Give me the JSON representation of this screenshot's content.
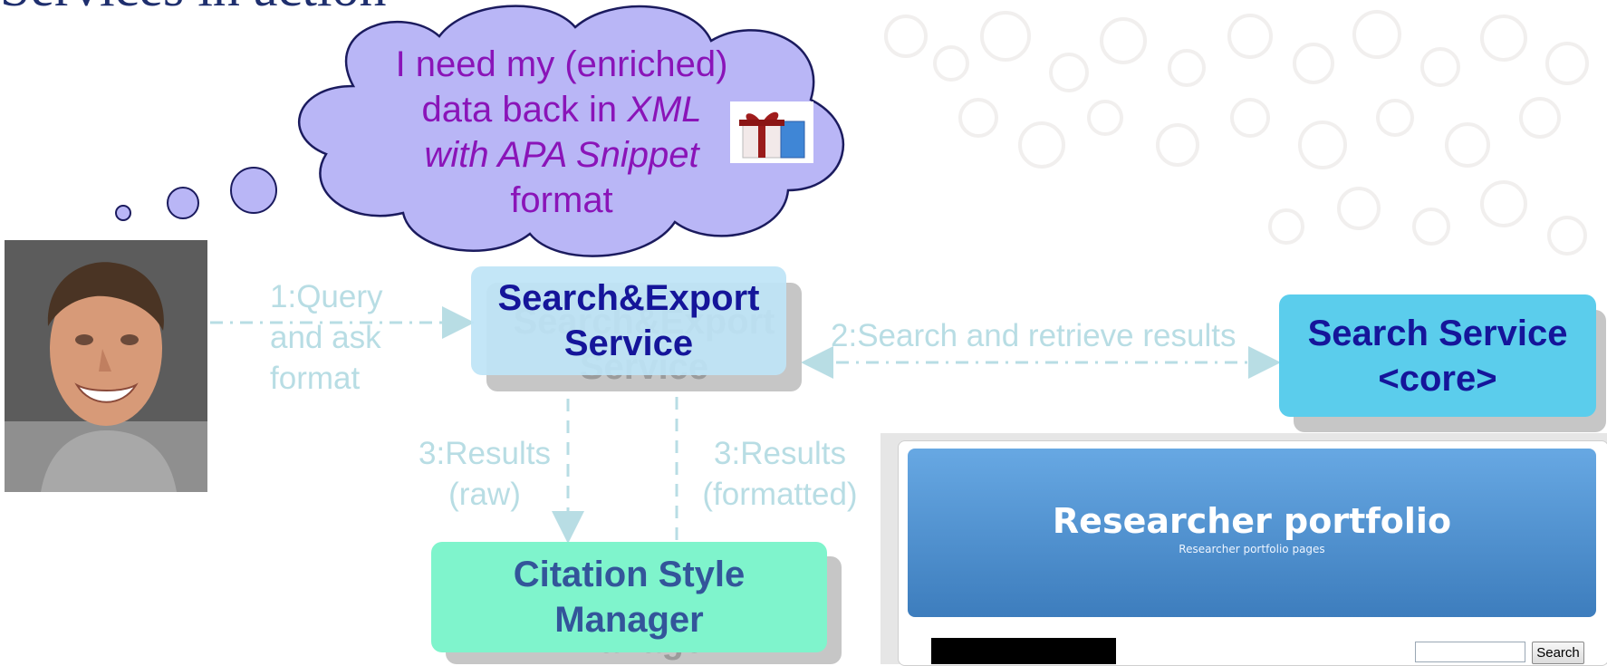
{
  "title": "Services in action",
  "thought": {
    "line1": "I need my (enriched)",
    "line2_prefix": "data back in ",
    "line2_italic": "XML",
    "line3_italic": "with APA Snippet",
    "line4": "format"
  },
  "boxes": {
    "search_export": {
      "line1": "Search&Export",
      "line2": "Service"
    },
    "search_service": {
      "line1": "Search Service",
      "line2": "<core>"
    },
    "citation": {
      "line1": "Citation Style",
      "line2": "Manager"
    }
  },
  "labels": {
    "query": {
      "line1": "1:Query",
      "line2": "and ask",
      "line3": "format"
    },
    "search_retrieve": "2:Search and retrieve results",
    "results_raw": {
      "line1": "3:Results",
      "line2": "(raw)"
    },
    "results_formatted": {
      "line1": "3:Results",
      "line2": "(formatted)"
    }
  },
  "portfolio": {
    "title": "Researcher portfolio",
    "subtitle": "Researcher portfolio pages",
    "search_button": "Search",
    "search_value": ""
  },
  "colors": {
    "title": "#1f2f6e",
    "thought_text": "#8a14b8",
    "cloud_fill": "#b9b6f6",
    "box_text": "#15159a",
    "arrow": "#b8dde4",
    "search_export_fill": "#bee4f6",
    "search_service_fill": "#5bcdec",
    "citation_fill": "#7ff4cc"
  }
}
